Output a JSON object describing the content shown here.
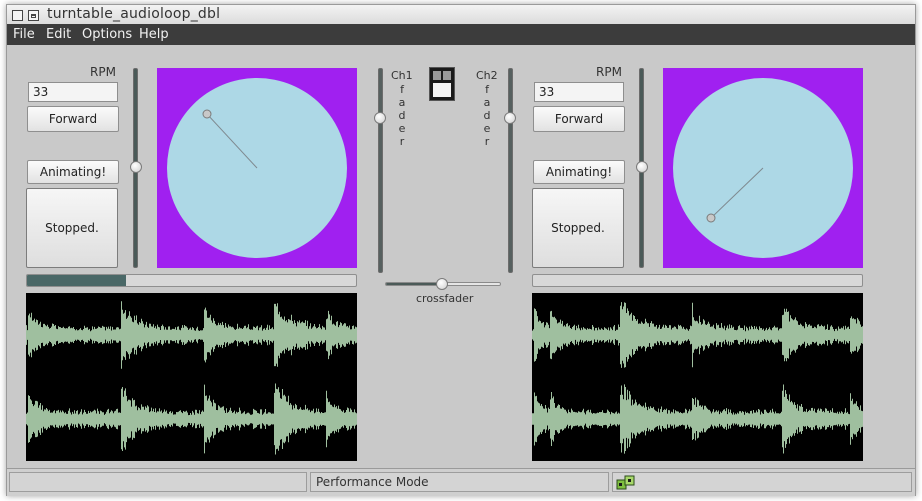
{
  "window": {
    "title": "turntable_audioloop_dbl"
  },
  "menu": [
    "File",
    "Edit",
    "Options",
    "Help"
  ],
  "deck_left": {
    "rpm_label": "RPM",
    "rpm_value": "33",
    "direction_label": "Forward",
    "animate_label": "Animating!",
    "state_label": "Stopped.",
    "progress": 0.3
  },
  "deck_right": {
    "rpm_label": "RPM",
    "rpm_value": "33",
    "direction_label": "Forward",
    "animate_label": "Animating!",
    "state_label": "Stopped.",
    "progress": 0.0
  },
  "mixer": {
    "ch1_label": "Ch1",
    "ch2_label": "Ch2",
    "fader_letters": [
      "f",
      "a",
      "d",
      "e",
      "r"
    ],
    "crossfader_label": "crossfader"
  },
  "status": {
    "mode_text": "Performance Mode",
    "icon": "network-link-icon"
  },
  "colors": {
    "deck_background": "#a020f0",
    "platter": "#add8e6",
    "waveform": "#9fbf9f",
    "waveform_background": "#000000",
    "menubar": "#3c3c3c"
  }
}
